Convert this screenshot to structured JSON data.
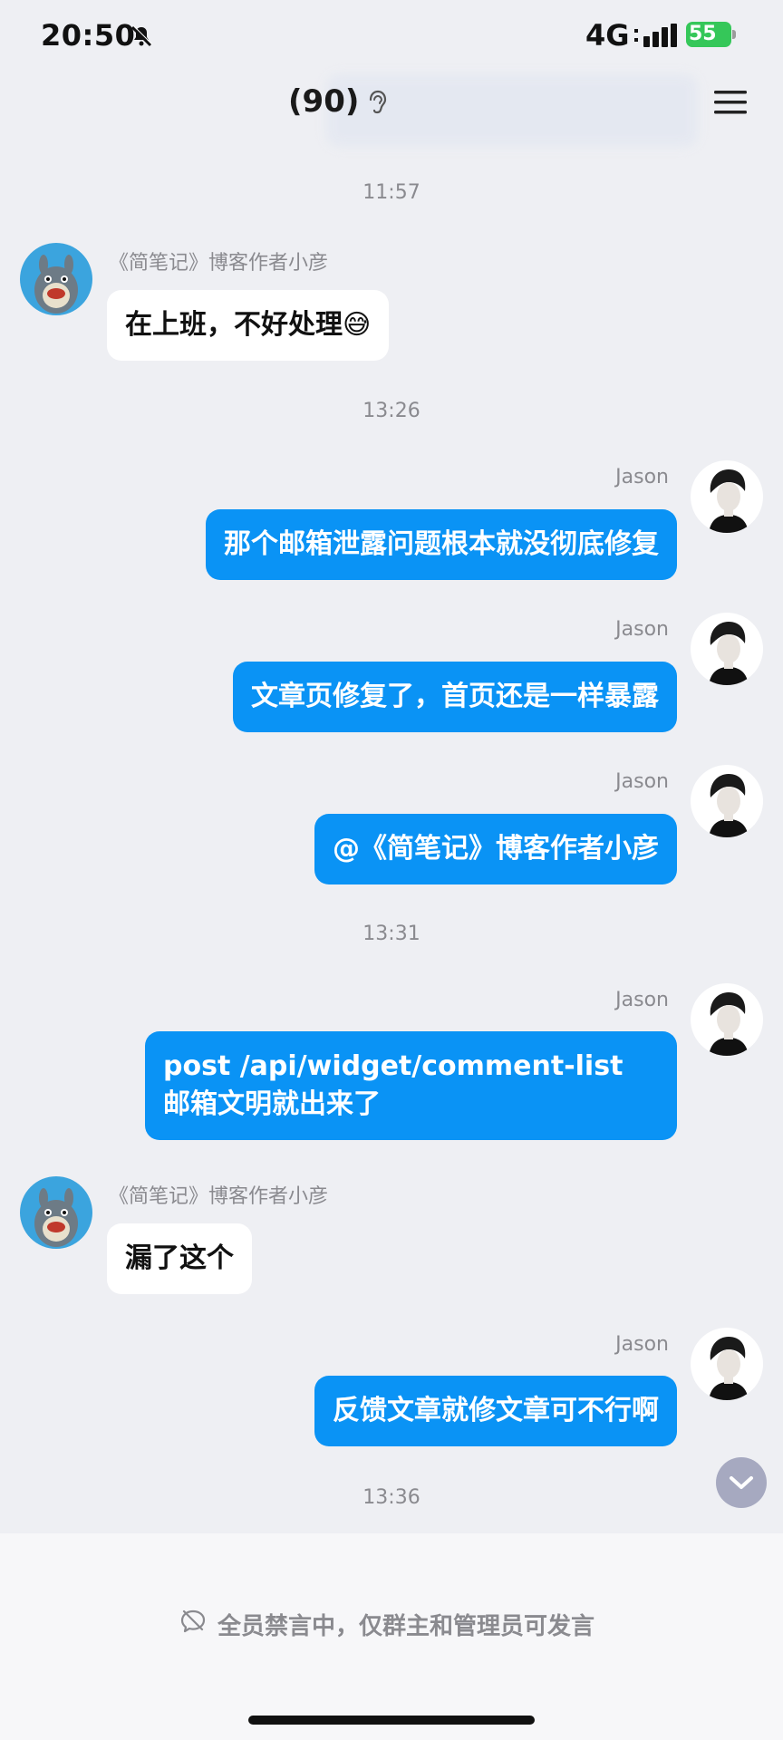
{
  "status_bar": {
    "time": "20:50",
    "network": "4G",
    "battery": "55",
    "battery_color": "#35c759"
  },
  "header": {
    "title": "(90)",
    "icons": [
      "ear-icon",
      "menu-icon"
    ]
  },
  "messages": [
    {
      "type": "timestamp",
      "text": "11:57"
    },
    {
      "type": "incoming",
      "sender": "《简笔记》博客作者小彦",
      "text": "在上班，不好处理",
      "emoji": "😅"
    },
    {
      "type": "timestamp",
      "text": "13:26"
    },
    {
      "type": "outgoing",
      "sender": "Jason",
      "text": "那个邮箱泄露问题根本就没彻底修复"
    },
    {
      "type": "outgoing",
      "sender": "Jason",
      "text": "文章页修复了，首页还是一样暴露"
    },
    {
      "type": "outgoing",
      "sender": "Jason",
      "text": "@《简笔记》博客作者小彦"
    },
    {
      "type": "timestamp",
      "text": "13:31"
    },
    {
      "type": "outgoing",
      "sender": "Jason",
      "line1": "post /api/widget/comment-list",
      "line2": "邮箱文明就出来了"
    },
    {
      "type": "incoming",
      "sender": "《简笔记》博客作者小彦",
      "text": "漏了这个"
    },
    {
      "type": "outgoing",
      "sender": "Jason",
      "text": "反馈文章就修文章可不行啊"
    },
    {
      "type": "timestamp",
      "text": "13:36"
    }
  ],
  "footer": {
    "mute_notice": "全员禁言中，仅群主和管理员可发言"
  },
  "colors": {
    "outgoing_bubble": "#0a93f5",
    "incoming_bubble": "#ffffff",
    "background": "#eeeff3"
  }
}
